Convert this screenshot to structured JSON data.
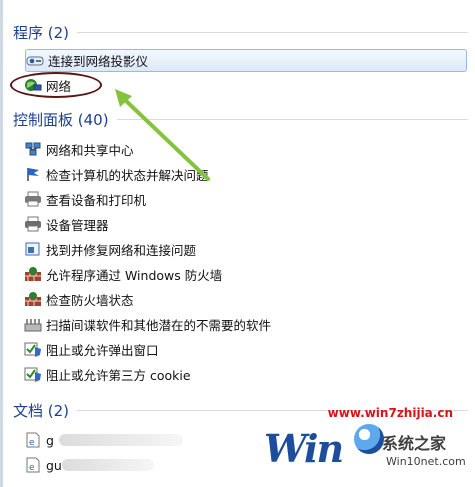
{
  "search_results": {
    "programs": {
      "title": "程序 (2)",
      "items": [
        {
          "label": "连接到网络投影仪",
          "icon": "projector-icon"
        },
        {
          "label": "网络",
          "icon": "network-icon"
        }
      ]
    },
    "control_panel": {
      "title": "控制面板 (40)",
      "items": [
        {
          "label": "网络和共享中心",
          "icon": "network-center-icon"
        },
        {
          "label": "检查计算机的状态并解决问题",
          "icon": "flag-icon"
        },
        {
          "label": "查看设备和打印机",
          "icon": "printer-icon"
        },
        {
          "label": "设备管理器",
          "icon": "printer-icon"
        },
        {
          "label": "找到并修复网络和连接问题",
          "icon": "troubleshoot-icon"
        },
        {
          "label": "允许程序通过 Windows 防火墙",
          "icon": "firewall-icon"
        },
        {
          "label": "检查防火墙状态",
          "icon": "firewall-icon"
        },
        {
          "label": "扫描间谍软件和其他潜在的不需要的软件",
          "icon": "scan-icon"
        },
        {
          "label": "阻止或允许弹出窗口",
          "icon": "ie-shield-icon"
        },
        {
          "label": "阻止或允许第三方 cookie",
          "icon": "ie-shield-icon"
        }
      ]
    },
    "documents": {
      "title": "文档 (2)",
      "items": [
        {
          "label": "g",
          "icon": "document-icon"
        },
        {
          "label": "gu",
          "icon": "document-icon"
        }
      ]
    }
  },
  "watermark": {
    "url": "www.win7zhijia.cn",
    "logo": "Win",
    "name": "系统之家",
    "domain": "Win10net.com"
  },
  "colors": {
    "group_title": "#1e3f8f",
    "selection_border": "#9bb8de",
    "annotation_ellipse": "#5a1616",
    "annotation_arrow": "#85c23d",
    "watermark_red": "#d61616"
  }
}
